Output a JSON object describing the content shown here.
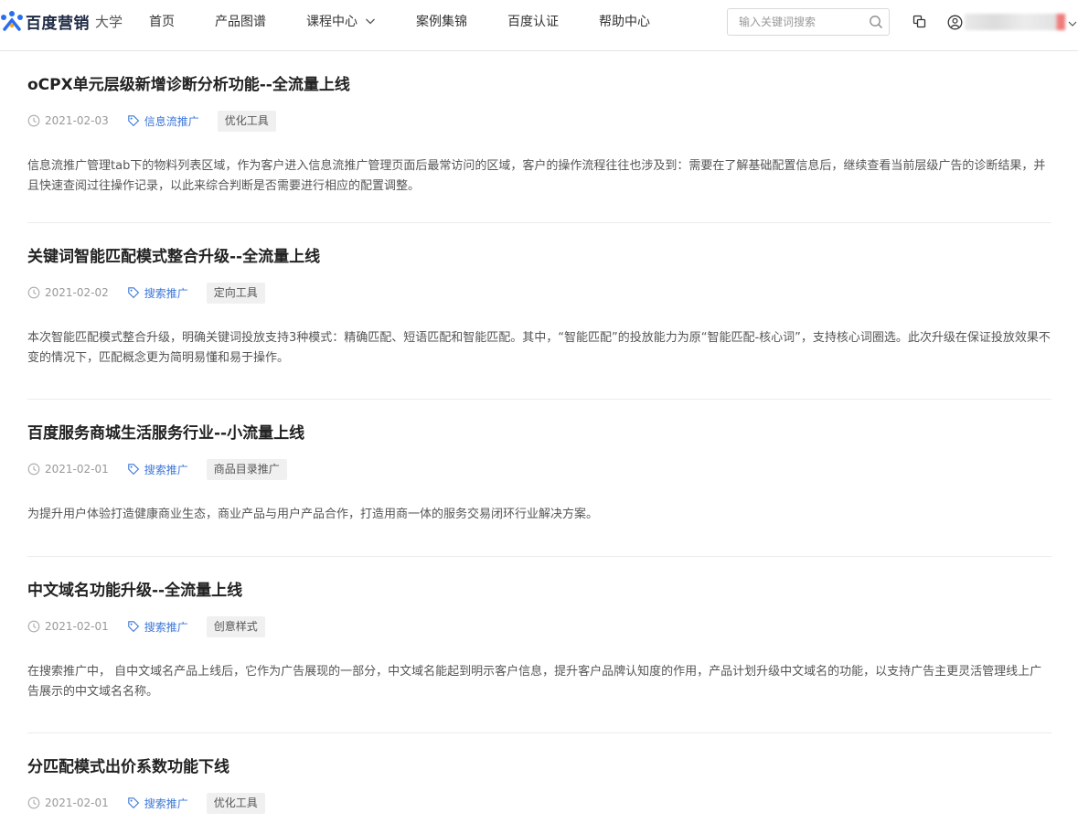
{
  "header": {
    "logo_text": "百度营销",
    "logo_sub": "大学",
    "nav": [
      {
        "label": "首页"
      },
      {
        "label": "产品图谱"
      },
      {
        "label": "课程中心"
      },
      {
        "label": "案例集锦"
      },
      {
        "label": "百度认证"
      },
      {
        "label": "帮助中心"
      }
    ],
    "search_placeholder": "输入关键词搜索",
    "accent_color": "#3a76d8"
  },
  "articles": [
    {
      "title": "oCPX单元层级新增诊断分析功能--全流量上线",
      "date": "2021-02-03",
      "category": "信息流推广",
      "tag": "优化工具",
      "summary": "信息流推广管理tab下的物料列表区域，作为客户进入信息流推广管理页面后最常访问的区域，客户的操作流程往往也涉及到：需要在了解基础配置信息后，继续查看当前层级广告的诊断结果，并且快速查阅过往操作记录，以此来综合判断是否需要进行相应的配置调整。"
    },
    {
      "title": "关键词智能匹配模式整合升级--全流量上线",
      "date": "2021-02-02",
      "category": "搜索推广",
      "tag": "定向工具",
      "summary": "本次智能匹配模式整合升级，明确关键词投放支持3种模式：精确匹配、短语匹配和智能匹配。其中，“智能匹配”的投放能力为原“智能匹配-核心词”，支持核心词圈选。此次升级在保证投放效果不变的情况下，匹配概念更为简明易懂和易于操作。"
    },
    {
      "title": "百度服务商城生活服务行业--小流量上线",
      "date": "2021-02-01",
      "category": "搜索推广",
      "tag": "商品目录推广",
      "summary": "为提升用户体验打造健康商业生态，商业产品与用户产品合作，打造用商一体的服务交易闭环行业解决方案。"
    },
    {
      "title": "中文域名功能升级--全流量上线",
      "date": "2021-02-01",
      "category": "搜索推广",
      "tag": "创意样式",
      "summary": "在搜索推广中， 自中文域名产品上线后，它作为广告展现的一部分，中文域名能起到明示客户信息，提升客户品牌认知度的作用，产品计划升级中文域名的功能，以支持广告主更灵活管理线上广告展示的中文域名名称。"
    },
    {
      "title": "分匹配模式出价系数功能下线",
      "date": "2021-02-01",
      "category": "搜索推广",
      "tag": "优化工具",
      "summary": ""
    }
  ]
}
